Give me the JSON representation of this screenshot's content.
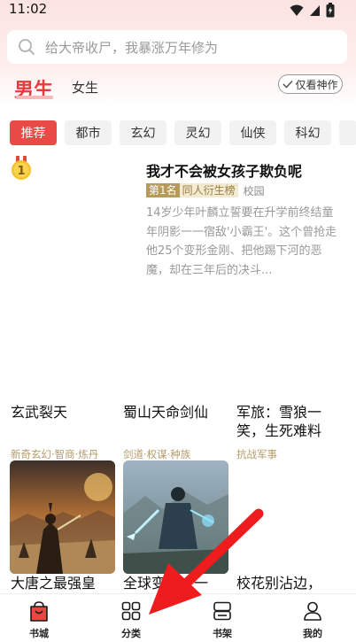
{
  "status_bar": {
    "time": "11:02"
  },
  "search": {
    "placeholder": "给大帝收尸，我暴涨万年修为"
  },
  "gender_tabs": {
    "male": "男生",
    "female": "女生"
  },
  "filter_button": {
    "label": "仅看神作"
  },
  "categories": [
    "推荐",
    "都市",
    "玄幻",
    "灵幻",
    "仙侠",
    "科幻"
  ],
  "featured": {
    "rank": "1",
    "title": "我才不会被女孩子欺负呢",
    "rank_tag": "第1名",
    "list_tag": "同人衍生榜",
    "genre": "校园",
    "description": "14岁少年叶麟立誓要在升学前终结童年阴影一一宿敌'小霸王'。这个曾抢走他25个变形金刚、把他踢下河的恶魔，却在三年后的决斗..."
  },
  "grid_row1": [
    {
      "title": "玄武裂天",
      "tag": "新奇玄幻·智商·炼丹"
    },
    {
      "title": "蜀山天命剑仙",
      "tag": "剑道·权谋·种族"
    },
    {
      "title": "军旅：雪狼一笑，生死难料",
      "tag": "抗战军事"
    }
  ],
  "grid_row2": [
    {
      "title": "大唐之最强皇"
    },
    {
      "title": "全球变异，一"
    },
    {
      "title": "校花别沾边，"
    }
  ],
  "bottom_nav": [
    {
      "label": "书城",
      "icon": "bookstore-icon",
      "active": true
    },
    {
      "label": "分类",
      "icon": "category-grid-icon"
    },
    {
      "label": "书架",
      "icon": "bookshelf-icon"
    },
    {
      "label": "我的",
      "icon": "profile-icon"
    }
  ],
  "colors": {
    "accent": "#e23c3c",
    "chip_active": "#ea4a45",
    "tag_gold": "#b69a5a"
  }
}
